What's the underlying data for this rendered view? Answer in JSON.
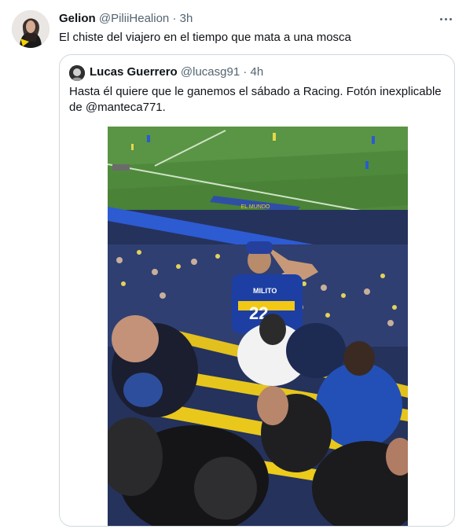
{
  "tweet": {
    "author_name": "Gelion",
    "author_handle": "@PiliiHealion",
    "separator": "·",
    "time": "3h",
    "text": "El chiste del viajero en el tiempo que mata a una mosca"
  },
  "quoted_tweet": {
    "author_name": "Lucas Guerrero",
    "author_handle": "@lucasg91",
    "separator": "·",
    "time": "4h",
    "text": "Hasta él quiere que le ganemos el sábado a Racing. Fotón inexplicable de @manteca771.",
    "photo": {
      "jersey_name": "MILITO",
      "jersey_number": "22",
      "pitch_board_text": "EL MUNDO"
    }
  },
  "icons": {
    "more": "more-dots-icon"
  },
  "colors": {
    "text": "#0f1419",
    "secondary": "#536471",
    "border": "#cfd9de"
  }
}
